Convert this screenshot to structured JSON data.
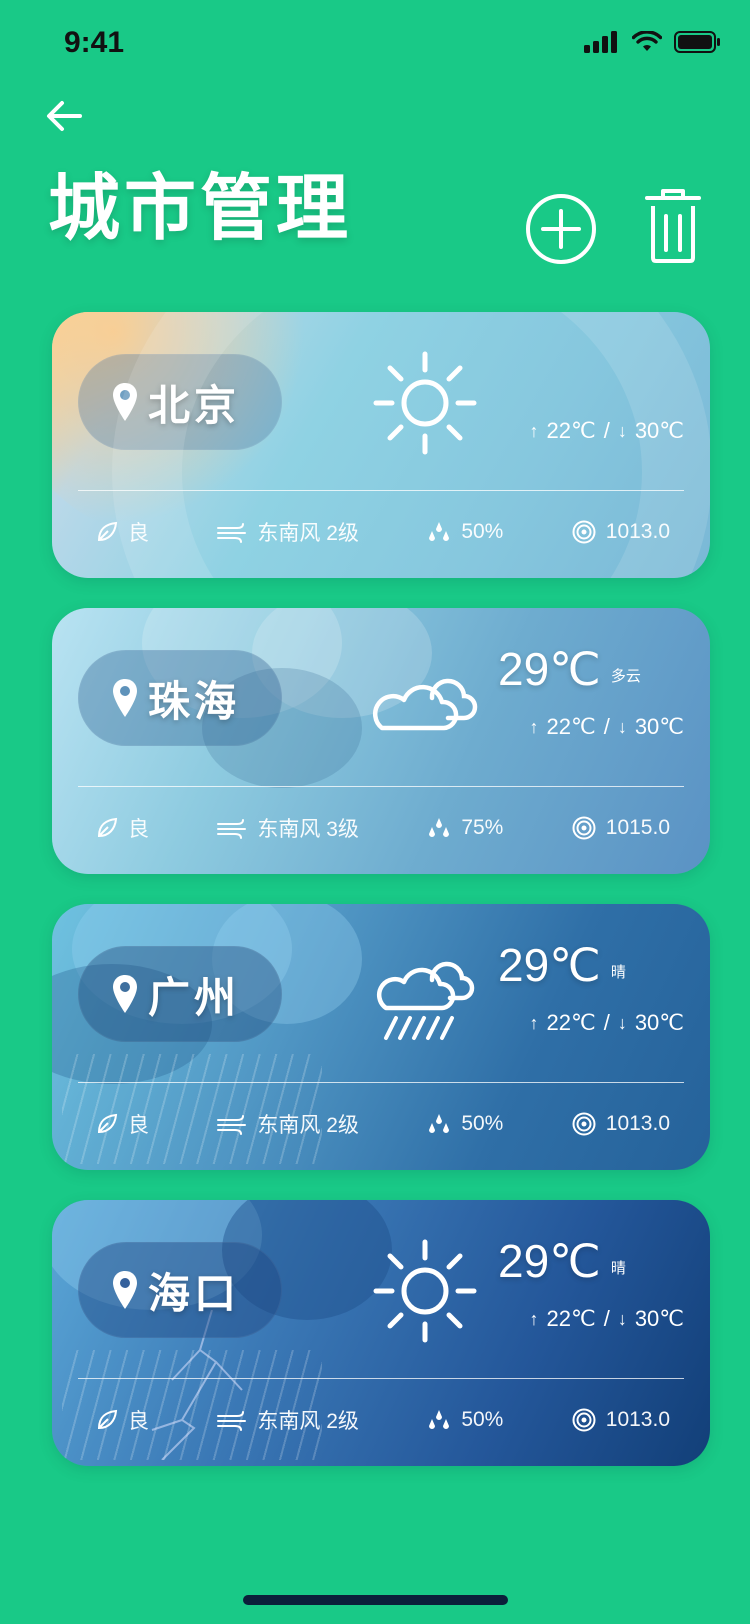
{
  "status": {
    "time": "9:41"
  },
  "header": {
    "title": "城市管理"
  },
  "cards": [
    {
      "city": "北京",
      "icon": "sun-icon",
      "temp": "",
      "condition": "",
      "low": "22℃",
      "high": "30℃",
      "aqi": "良",
      "wind": "东南风 2级",
      "humidity": "50%",
      "pressure": "1013.0"
    },
    {
      "city": "珠海",
      "icon": "cloud-icon",
      "temp": "29℃",
      "condition": "多云",
      "low": "22℃",
      "high": "30℃",
      "aqi": "良",
      "wind": "东南风 3级",
      "humidity": "75%",
      "pressure": "1015.0"
    },
    {
      "city": "广州",
      "icon": "rain-icon",
      "temp": "29℃",
      "condition": "晴",
      "low": "22℃",
      "high": "30℃",
      "aqi": "良",
      "wind": "东南风 2级",
      "humidity": "50%",
      "pressure": "1013.0"
    },
    {
      "city": "海口",
      "icon": "sun-icon",
      "temp": "29℃",
      "condition": "晴",
      "low": "22℃",
      "high": "30℃",
      "aqi": "良",
      "wind": "东南风 2级",
      "humidity": "50%",
      "pressure": "1013.0"
    }
  ],
  "colors": {
    "background": "#19c987",
    "text": "#ffffff"
  }
}
